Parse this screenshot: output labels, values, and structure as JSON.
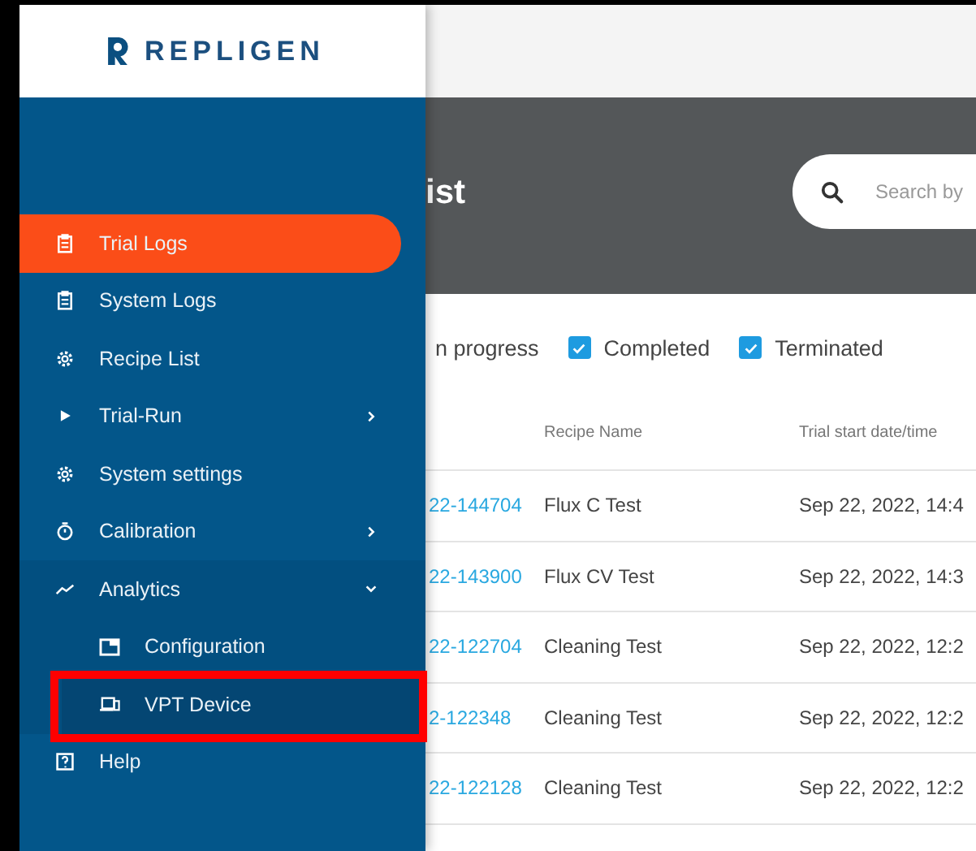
{
  "sidebar": {
    "logo": "REPLIGEN",
    "items": [
      {
        "label": "Trial Logs",
        "selected": true
      },
      {
        "label": "System Logs",
        "selected": false
      },
      {
        "label": "Recipe List",
        "selected": false
      },
      {
        "label": "Trial-Run",
        "selected": false,
        "expanded": false
      },
      {
        "label": "System settings",
        "selected": false
      },
      {
        "label": "Calibration",
        "selected": false,
        "expanded": false
      },
      {
        "label": "Analytics",
        "selected": false,
        "expanded": true,
        "children": [
          {
            "label": "Configuration",
            "selected": false
          },
          {
            "label": "VPT Device",
            "selected": true
          }
        ]
      },
      {
        "label": "Help",
        "selected": false
      }
    ]
  },
  "header": {
    "title": "ist",
    "search": {
      "placeholder": "Search by"
    }
  },
  "filters": [
    {
      "label": "n progress"
    },
    {
      "label": "Completed",
      "checked": true
    },
    {
      "label": "Terminated",
      "checked": true
    }
  ],
  "table": {
    "columns": [
      "Recipe Name",
      "Trial start date/time"
    ],
    "rows": [
      {
        "id": "22-144704",
        "recipe": "Flux C Test",
        "start": "Sep 22, 2022, 14:4"
      },
      {
        "id": "22-143900",
        "recipe": "Flux CV Test",
        "start": "Sep 22, 2022, 14:3"
      },
      {
        "id": "22-122704",
        "recipe": "Cleaning Test",
        "start": "Sep 22, 2022, 12:2"
      },
      {
        "id": "2-122348",
        "recipe": "Cleaning Test",
        "start": "Sep 22, 2022, 12:2"
      },
      {
        "id": "22-122128",
        "recipe": "Cleaning Test",
        "start": "Sep 22, 2022, 12:2"
      }
    ]
  }
}
